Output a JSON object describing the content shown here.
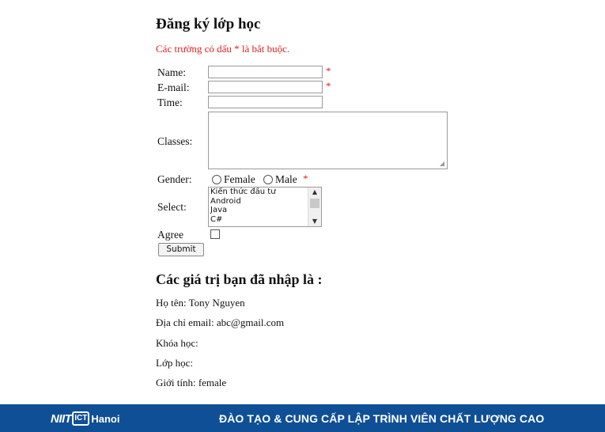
{
  "form": {
    "title": "Đăng ký lớp học",
    "required_note": "Các trường có dấu * là bắt buộc.",
    "required_mark": "*",
    "name_label": "Name:",
    "email_label": "E-mail:",
    "time_label": "Time:",
    "classes_label": "Classes:",
    "gender_label": "Gender:",
    "gender_options": [
      "Female",
      "Male"
    ],
    "select_label": "Select:",
    "select_options": [
      "Kiến thức đầu tư",
      "Android",
      "Java",
      "C#"
    ],
    "agree_label": "Agree",
    "submit_label": "Submit"
  },
  "results": {
    "title": "Các giá trị bạn đã nhập là :",
    "lines": [
      "Họ tên: Tony Nguyen",
      "Địa chỉ email: abc@gmail.com",
      "Khóa học:",
      "Lớp học:",
      "Giới tính: female"
    ]
  },
  "footer": {
    "logo_text": "NIIT",
    "logo_badge": "ICT",
    "logo_city": "Hanoi",
    "slogan": "ĐÀO TẠO & CUNG CẤP LẬP TRÌNH VIÊN CHẤT LƯỢNG CAO",
    "background_color": "#0f4f96"
  }
}
